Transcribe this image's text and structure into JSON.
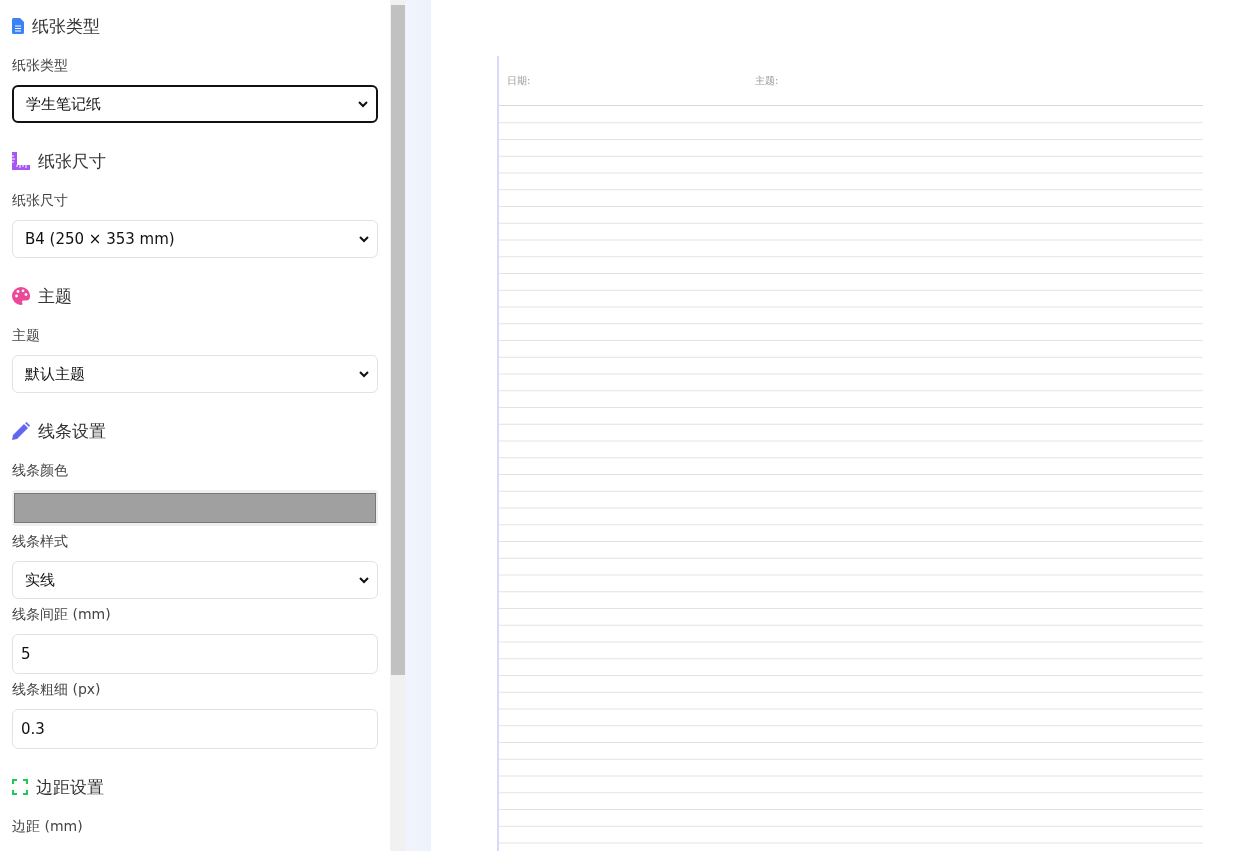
{
  "sidebar": {
    "sections": [
      {
        "title": "纸张类型",
        "fields": [
          {
            "kind": "select",
            "label": "纸张类型",
            "value": "学生笔记纸",
            "focused": true
          }
        ]
      },
      {
        "title": "纸张尺寸",
        "fields": [
          {
            "kind": "select",
            "label": "纸张尺寸",
            "value": "B4 (250 × 353 mm)",
            "focused": false
          }
        ]
      },
      {
        "title": "主题",
        "fields": [
          {
            "kind": "select",
            "label": "主题",
            "value": "默认主题",
            "focused": false
          }
        ]
      },
      {
        "title": "线条设置",
        "fields": [
          {
            "kind": "color",
            "label": "线条颜色",
            "color": "#a0a0a0"
          },
          {
            "kind": "select",
            "label": "线条样式",
            "value": "实线",
            "focused": false
          },
          {
            "kind": "number",
            "label": "线条间距 (mm)",
            "value": "5"
          },
          {
            "kind": "number",
            "label": "线条粗细 (px)",
            "value": "0.3"
          }
        ]
      },
      {
        "title": "边距设置",
        "fields": [
          {
            "kind": "label",
            "label": "边距 (mm)"
          }
        ]
      }
    ]
  },
  "paper": {
    "date_label": "日期:",
    "subject_label": "主题:"
  }
}
